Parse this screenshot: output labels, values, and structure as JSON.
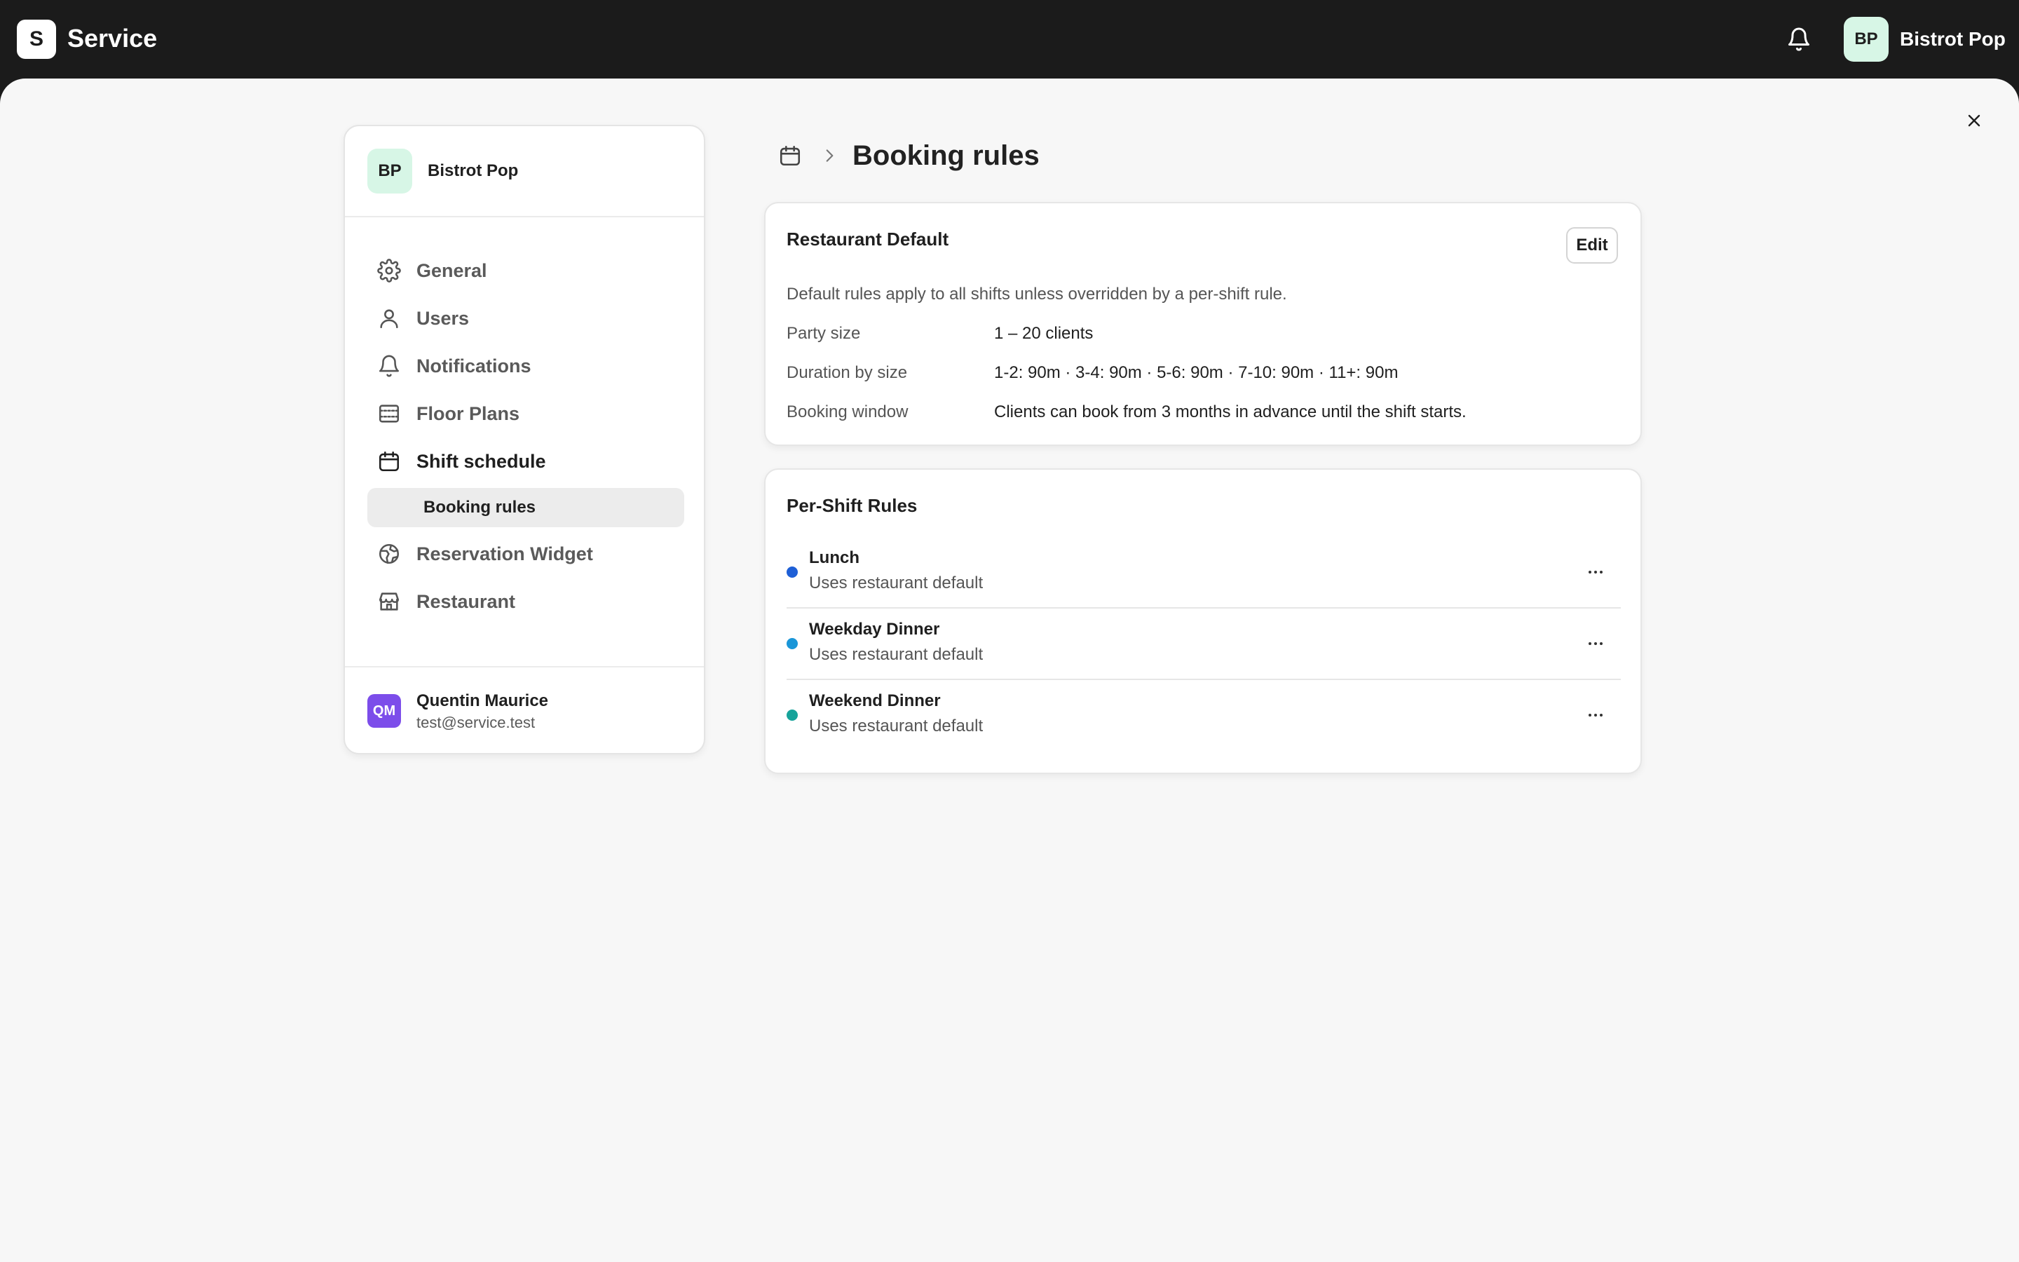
{
  "topbar": {
    "logo_letter": "S",
    "app_name": "Service",
    "user_initials": "BP",
    "user_name": "Bistrot Pop"
  },
  "sidebar": {
    "restaurant_initials": "BP",
    "restaurant_name": "Bistrot Pop",
    "items": [
      {
        "label": "General",
        "icon": "gear-icon"
      },
      {
        "label": "Users",
        "icon": "user-icon"
      },
      {
        "label": "Notifications",
        "icon": "bell-icon"
      },
      {
        "label": "Floor Plans",
        "icon": "floor-plan-icon"
      },
      {
        "label": "Shift schedule",
        "icon": "calendar-icon"
      },
      {
        "label": "Booking rules",
        "icon": ""
      },
      {
        "label": "Reservation Widget",
        "icon": "globe-icon"
      },
      {
        "label": "Restaurant",
        "icon": "store-icon"
      }
    ],
    "footer": {
      "initials": "QM",
      "name": "Quentin Maurice",
      "email": "test@service.test",
      "avatar_color": "#7c4dea"
    }
  },
  "breadcrumb": {
    "title": "Booking rules"
  },
  "restaurant_default": {
    "title": "Restaurant Default",
    "edit_label": "Edit",
    "description": "Default rules apply to all shifts unless overridden by a per-shift rule.",
    "rows": [
      {
        "key": "Party size",
        "value": "1 – 20 clients"
      },
      {
        "key": "Duration by size",
        "value": "1-2: 90m · 3-4: 90m · 5-6: 90m · 7-10: 90m · 11+: 90m"
      },
      {
        "key": "Booking window",
        "value": "Clients can book from 3 months in advance until the shift starts."
      }
    ]
  },
  "per_shift": {
    "title": "Per-Shift Rules",
    "shifts": [
      {
        "name": "Lunch",
        "status": "Uses restaurant default",
        "color": "#1e5fd6"
      },
      {
        "name": "Weekday Dinner",
        "status": "Uses restaurant default",
        "color": "#1a96d8"
      },
      {
        "name": "Weekend Dinner",
        "status": "Uses restaurant default",
        "color": "#16a39a"
      }
    ]
  }
}
